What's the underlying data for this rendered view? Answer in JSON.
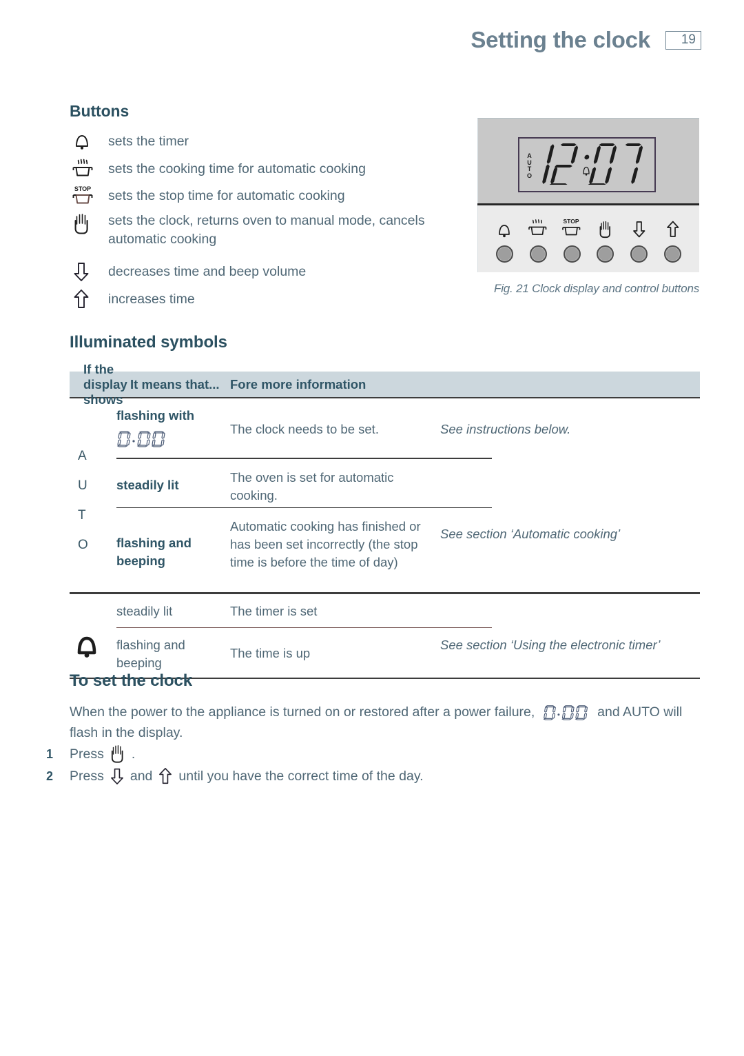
{
  "header": {
    "title": "Setting the clock",
    "page_number": "19"
  },
  "buttons_section": {
    "heading": "Buttons",
    "items": [
      {
        "icon": "bell-icon",
        "label": "sets the timer"
      },
      {
        "icon": "pot-steam-icon",
        "label": "sets the cooking time for automatic cooking"
      },
      {
        "icon": "pot-stop-icon",
        "label": "sets the stop time for automatic cooking"
      },
      {
        "icon": "hand-icon",
        "label": "sets the clock, returns oven to manual mode, cancels automatic cooking"
      },
      {
        "icon": "arrow-down-icon",
        "label": "decreases time and beep volume"
      },
      {
        "icon": "arrow-up-icon",
        "label": "increases time"
      }
    ]
  },
  "figure": {
    "caption": "Fig. 21 Clock display and control buttons",
    "display": {
      "auto_indicator": "AUTO",
      "auto_letters": [
        "A",
        "U",
        "T",
        "O"
      ],
      "time": "12:07",
      "hours": "12",
      "minutes": "07",
      "bell_indicator": "bell-segment-icon"
    },
    "control_buttons": [
      {
        "icon": "bell-icon",
        "name": "timer-button"
      },
      {
        "icon": "pot-steam-icon",
        "name": "cook-time-button"
      },
      {
        "icon": "pot-stop-icon",
        "name": "stop-time-button",
        "label": "STOP"
      },
      {
        "icon": "hand-icon",
        "name": "manual-button"
      },
      {
        "icon": "arrow-down-icon",
        "name": "decrease-button"
      },
      {
        "icon": "arrow-up-icon",
        "name": "increase-button"
      }
    ]
  },
  "symbols_section": {
    "heading": "Illuminated symbols",
    "table": {
      "columns": [
        "If the display shows",
        "It means that...",
        "Fore more information"
      ],
      "groups": [
        {
          "symbol": "AUTO",
          "symbol_letters": [
            "A",
            "U",
            "T",
            "O"
          ],
          "rows": [
            {
              "when": "flashing with",
              "when_lcd": "0.00",
              "means": "The clock needs to be set.",
              "more": "See instructions below."
            },
            {
              "when": "steadily lit",
              "means": "The oven is set for automatic cooking.",
              "more": "See section ‘Automatic cooking’"
            },
            {
              "when": "flashing and beeping",
              "means": "Automatic cooking has finished or has been set incorrectly (the stop time is before the time of day)",
              "more": ""
            }
          ]
        },
        {
          "symbol": "bell-icon",
          "rows": [
            {
              "when": "steadily lit",
              "means": "The timer is set",
              "more": "See section ‘Using the electronic timer’"
            },
            {
              "when": "flashing and beeping",
              "means": "The time is up",
              "more": ""
            }
          ]
        }
      ]
    }
  },
  "set_clock_section": {
    "heading": "To set the clock",
    "intro_part1": "When the power to the appliance is turned on or restored after a power failure,",
    "intro_lcd": "0.00",
    "intro_part2": "and AUTO will flash in the display.",
    "steps": [
      {
        "num": "1",
        "text_before": "Press",
        "icon": "hand-icon",
        "text_after": "."
      },
      {
        "num": "2",
        "text_before": "Press",
        "icon": "arrow-down-icon",
        "text_mid": "and",
        "icon2": "arrow-up-icon",
        "text_after": "until you have the correct time of the day."
      }
    ]
  },
  "colors": {
    "heading_blue": "#2b5060",
    "title_gray_blue": "#6b8190",
    "body_text": "#4f6775",
    "table_header_bg": "#ccd7dd",
    "panel_top_bg": "#c8c8c8",
    "panel_bottom_bg": "#ebebeb",
    "lcd_border": "#463a52"
  }
}
